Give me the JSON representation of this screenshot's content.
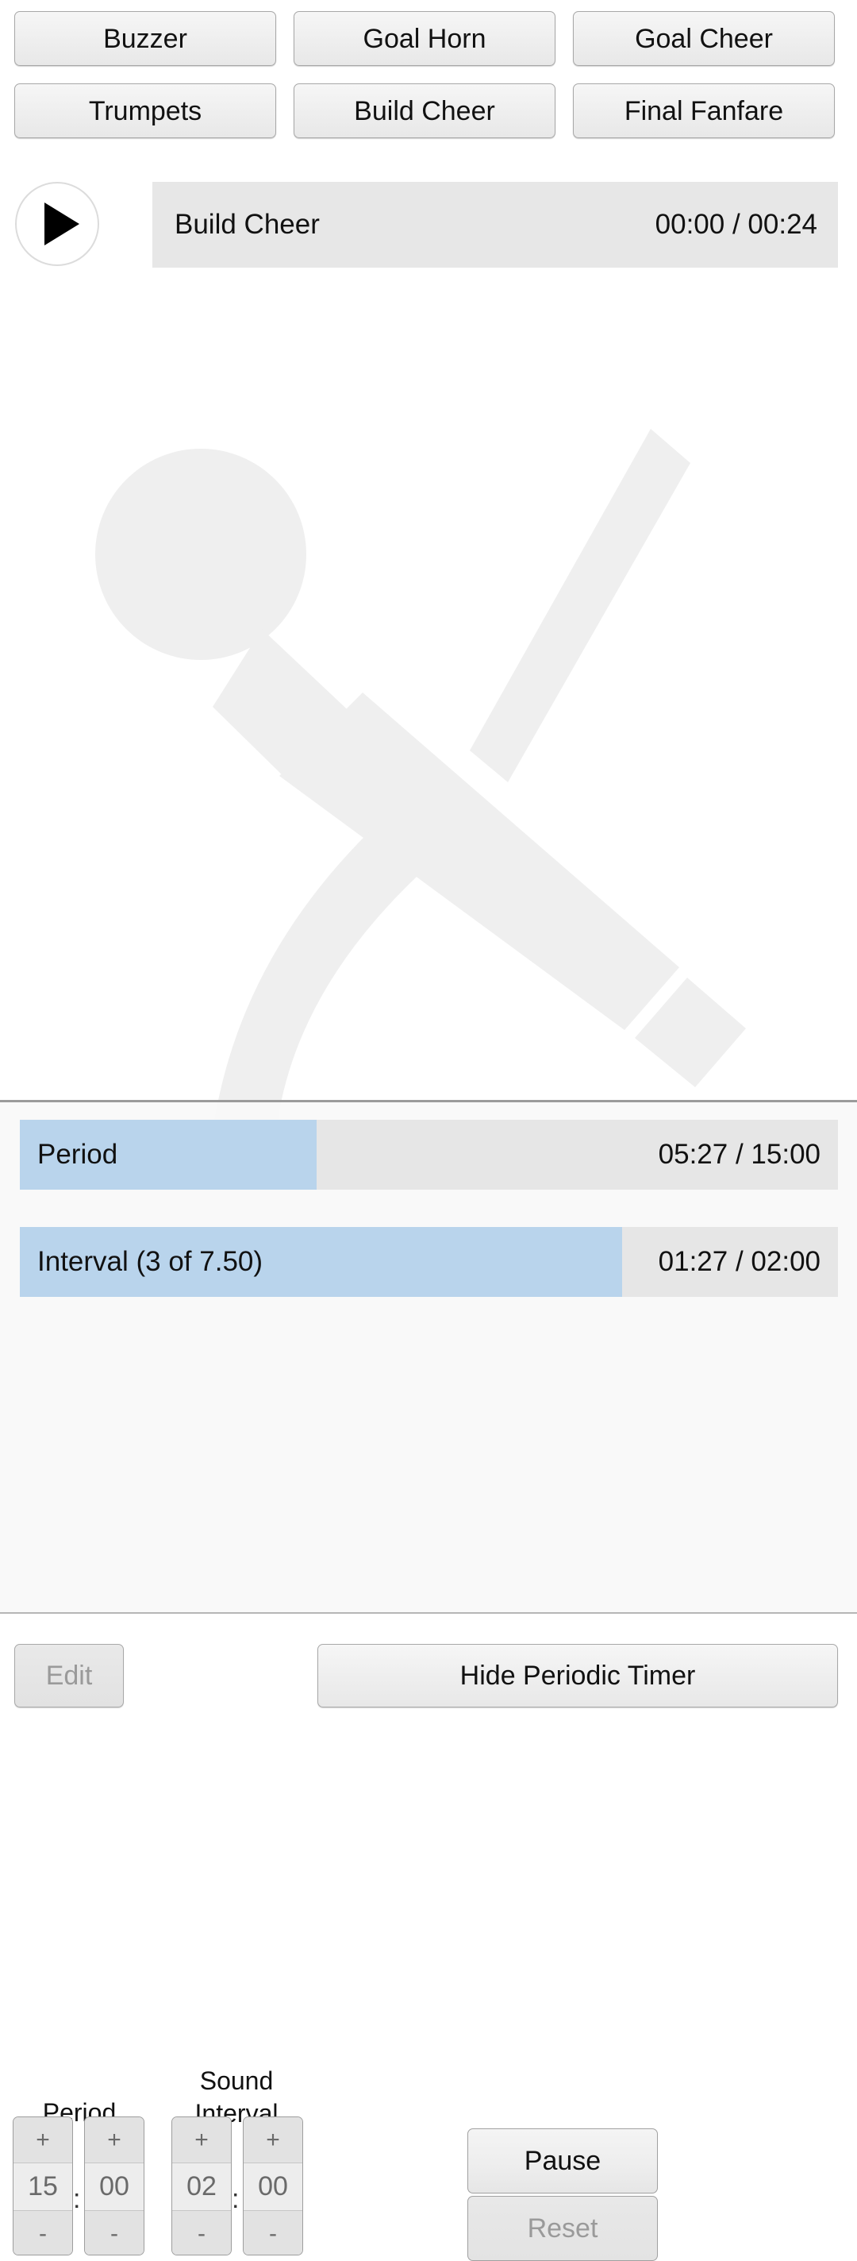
{
  "sounds": {
    "buttons": [
      {
        "label": "Buzzer"
      },
      {
        "label": "Goal Horn"
      },
      {
        "label": "Goal Cheer"
      },
      {
        "label": "Trumpets"
      },
      {
        "label": "Build Cheer"
      },
      {
        "label": "Final Fanfare"
      }
    ]
  },
  "player": {
    "play_icon": "play-icon",
    "track_title": "Build Cheer",
    "time": "00:00 / 00:24",
    "current_time": "00:00",
    "duration": "00:24"
  },
  "watermark": {
    "icon": "microphone-icon",
    "color": "#efefef"
  },
  "timer": {
    "period_bar": {
      "label": "Period",
      "time": "05:27 / 15:00",
      "elapsed": "05:27",
      "total": "15:00",
      "percent": 36.3
    },
    "interval_bar": {
      "label": "Interval (3 of 7.50)",
      "time": "01:27 / 02:00",
      "elapsed": "01:27",
      "total": "02:00",
      "index": 3,
      "count": "7.50",
      "percent": 73.6
    },
    "headings": {
      "period": "Period",
      "sound_interval_line1": "Sound",
      "sound_interval_line2": "Interval"
    },
    "steppers": {
      "plus_label": "+",
      "minus_label": "-",
      "separator": ":",
      "period_minutes": "15",
      "period_seconds": "00",
      "interval_minutes": "02",
      "interval_seconds": "00"
    },
    "controls": {
      "pause_label": "Pause",
      "reset_label": "Reset"
    },
    "accent_color": "#b9d4ec",
    "track_color": "#e6e6e6"
  },
  "bottom_bar": {
    "edit_label": "Edit",
    "hide_timer_label": "Hide Periodic Timer"
  }
}
